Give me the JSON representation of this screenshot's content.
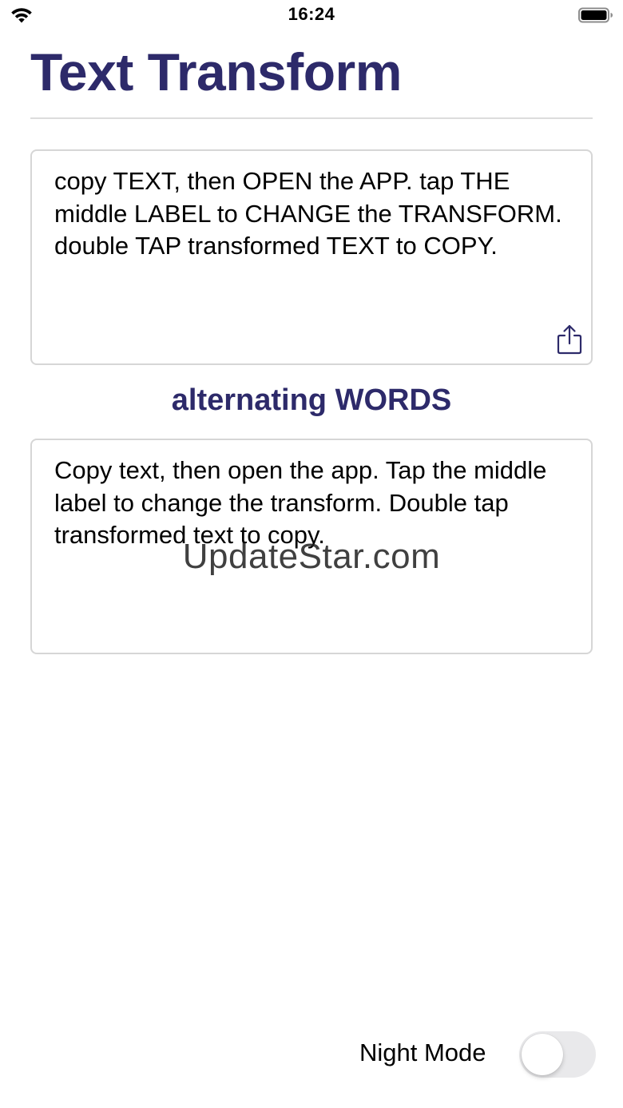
{
  "status_bar": {
    "time": "16:24",
    "wifi_icon": "wifi-icon",
    "battery_icon": "battery-icon"
  },
  "title": "Text Transform",
  "input": {
    "text": "copy TEXT, then OPEN the APP. tap THE middle LABEL to CHANGE the TRANSFORM. double TAP transformed TEXT to COPY.",
    "share_icon": "share-icon"
  },
  "transform_label": "alternating WORDS",
  "output": {
    "text": "Copy text, then open the app. Tap the middle label to change the transform. Double tap transformed text to copy."
  },
  "watermark": "UpdateStar.com",
  "night_mode": {
    "label": "Night Mode",
    "enabled": false
  },
  "colors": {
    "accent": "#2d2a6a",
    "border": "#d6d6d6",
    "toggle_off": "#e9e9eb"
  }
}
